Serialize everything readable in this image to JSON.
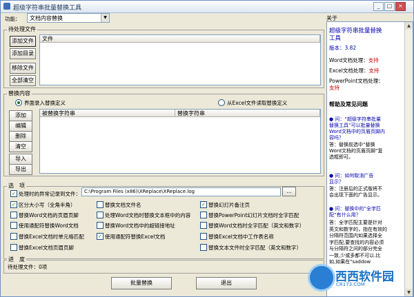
{
  "window": {
    "title": "超级字符串批量替换工具"
  },
  "function": {
    "label": "功能：",
    "value": "文档内容替换"
  },
  "pending": {
    "group_title": "待处理文件",
    "column": "文件",
    "buttons": {
      "add_file": "添加文件",
      "add_dir": "添加目录",
      "remove_file": "移除文件",
      "clear_all": "全部清空"
    }
  },
  "replace": {
    "group_title": "替换内容",
    "radio_ui": "界面录入替换定义",
    "radio_excel": "从Excel文件读取替换定义",
    "columns": {
      "find": "被替换字符串",
      "replace": "替换字符串"
    },
    "buttons": {
      "add": "添加",
      "edit": "编辑",
      "delete": "删除",
      "clear": "清空",
      "import": "导入",
      "export": "导出"
    }
  },
  "options": {
    "group_title": "选　项",
    "log_label": "处理时的异常记录到文件：",
    "log_path": "C:\\Program Files (x86)\\XReplace\\XReplace.log",
    "browse": "...",
    "items": [
      {
        "label": "区分大小写（全角半角）",
        "checked": true
      },
      {
        "label": "替换文档文件名",
        "checked": false
      },
      {
        "label": "替换幻灯片备注页",
        "checked": true
      },
      {
        "label": "替换Word文档的页眉页脚",
        "checked": false
      },
      {
        "label": "处理Word文档时替换文本框中的内容",
        "checked": false
      },
      {
        "label": "替换PowerPoint幻灯片文档时全字匹配",
        "checked": false
      },
      {
        "label": "使用通配符替换Word文档",
        "checked": false
      },
      {
        "label": "替换Word文档中的超链接地址",
        "checked": false
      },
      {
        "label": "替换Word文档时全字匹配（英文和数字）",
        "checked": false
      },
      {
        "label": "替换Excel文档时单元格匹配",
        "checked": false
      },
      {
        "label": "使用通配符替换Excel文档",
        "checked": true
      },
      {
        "label": "替换Excel文档中工作表名称",
        "checked": false
      },
      {
        "label": "替换Excel文档页眉页脚",
        "checked": false
      },
      {
        "label": "",
        "checked": false
      },
      {
        "label": "替换文本文件时全字匹配（英文和数字）",
        "checked": false
      }
    ]
  },
  "progress": {
    "group_title": "进　度",
    "status": "待处理文件：0项"
  },
  "footer": {
    "batch_replace": "批量替换",
    "exit": "退出"
  },
  "sidebar": {
    "header": "关于",
    "app_name_1": "超级字符串批量替换",
    "app_name_2": "工具",
    "version_label": "版本：",
    "version": "3.82",
    "support": [
      {
        "label": "Word文档处理：",
        "value": "支持"
      },
      {
        "label": "Excel文档处理：",
        "value": "支持"
      },
      {
        "label": "PowerPoint文档处理：",
        "value": "支持"
      }
    ],
    "help_title": "帮助及常见问题",
    "q1": [
      "问：“超级字符串批量",
      "替换工具”可以批量替换",
      "Word文档中的页眉页脚内",
      "容吗？"
    ],
    "a1": [
      "答：替换前选中“替换",
      "Word文档的页眉页脚”复",
      "选框即可。"
    ],
    "q2": [
      "问：如何取消广告",
      "显示？"
    ],
    "a2": [
      "答：注册后的正式版将不",
      "会出现下面的广告显示。"
    ],
    "q3": [
      "问：替换中的“全字匹",
      "配”有什么用？"
    ],
    "a3": [
      "答：全字匹配主要是针对",
      "英文和数字的，指在有效的",
      "分隔符范围内如果选择全",
      "字匹配,要查找的内容必须",
      "与分隔符之间的部分完全",
      "一致,少或多都不可以.比",
      "如,如果在\"saddow"
    ]
  },
  "watermark": {
    "text": "西西软件园",
    "sub": "CR173.COM"
  },
  "colors": {
    "link_blue": "#0000aa",
    "support_red": "#d00000",
    "title_text": "#1e395b"
  }
}
